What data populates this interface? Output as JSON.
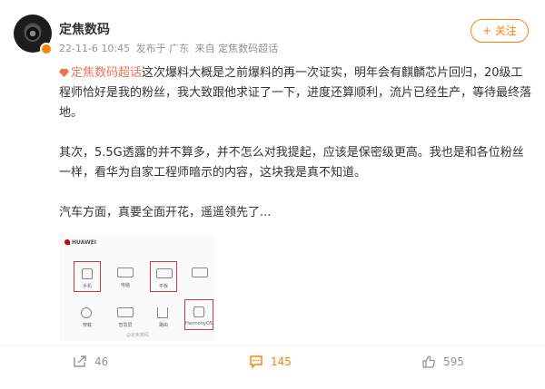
{
  "post": {
    "author": {
      "name": "定焦数码",
      "verified_badge_color": "#ff8200",
      "avatar_icon": "camera-lens-icon"
    },
    "meta": {
      "time": "22-11-6 10:45",
      "location": "发布于 广东",
      "source": "来自 定焦数码超话"
    },
    "follow_button": {
      "label": "+ 关注"
    },
    "topic_tag": "定焦数码超话",
    "paragraphs": [
      "这次爆料大概是之前爆料的再一次证实，明年会有麒麟芯片回归，20级工程师恰好是我的粉丝，我大致跟他求证了一下，进度还算顺利，流片已经生产，等待最终落地。",
      "其次，5.5G透露的并不算多，并不怎么对我提起，应该是保密级更高。我也是和各位粉丝一样，看华为自家工程师暗示的内容，这块我是真不知道。",
      "汽车方面，真要全面开花，遥遥领先了..."
    ],
    "image": {
      "brand": "HUAWEI",
      "tiles": [
        "手机",
        "电脑",
        "平板",
        "",
        "穿戴",
        "智慧屏",
        "路由",
        "HarmonyOS"
      ],
      "highlighted": [
        true,
        false,
        true,
        false,
        false,
        false,
        false,
        true
      ],
      "watermark": "@定焦数码"
    }
  },
  "actions": {
    "share_count": "46",
    "comment_count": "145",
    "like_count": "595"
  },
  "colors": {
    "accent": "#ff8200",
    "topic": "#eb7350",
    "text": "#333333",
    "muted": "#939393"
  }
}
